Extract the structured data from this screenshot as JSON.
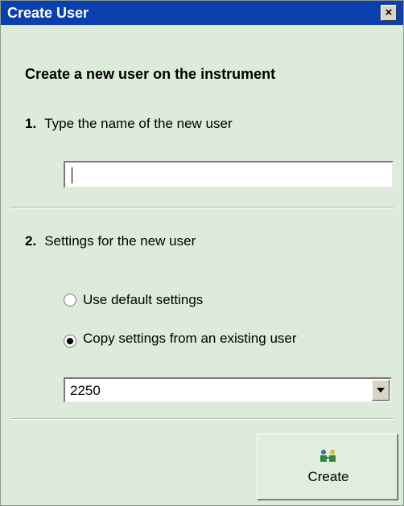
{
  "window": {
    "title": "Create User",
    "close_label": "×"
  },
  "heading": "Create a new user on the instrument",
  "step1": {
    "number": "1.",
    "label": "Type the name of the new user",
    "input_value": ""
  },
  "step2": {
    "number": "2.",
    "label": "Settings for the new user",
    "options": [
      {
        "label": "Use default settings",
        "selected": false
      },
      {
        "label": "Copy settings from an existing user",
        "selected": true
      }
    ],
    "existing_user": "2250"
  },
  "create_button": {
    "label": "Create",
    "icon": "users-icon"
  },
  "colors": {
    "titlebar": "#0b3fae",
    "background": "#ddebdb"
  }
}
